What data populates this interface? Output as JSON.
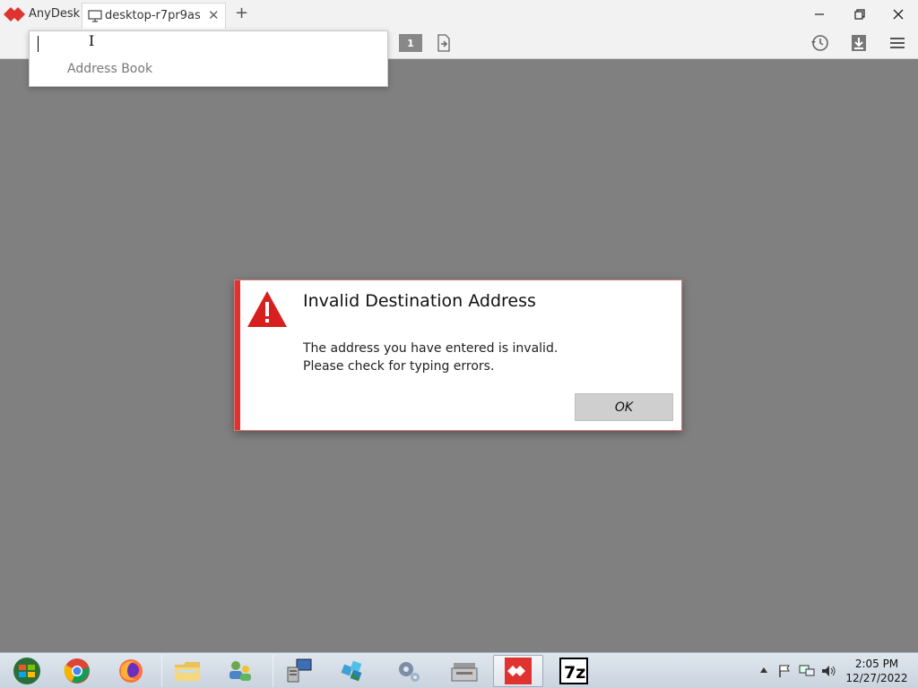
{
  "app": {
    "name": "AnyDesk",
    "tabs": [
      {
        "label": "desktop-r7pr9as"
      }
    ],
    "window_controls": {
      "minimize": "minimize-icon",
      "maximize": "restore-icon",
      "close": "close-icon"
    }
  },
  "toolbar": {
    "display_number": "1",
    "icons": [
      "monitor-number-icon",
      "file-transfer-icon",
      "history-icon",
      "download-icon",
      "menu-icon"
    ]
  },
  "address_dropdown": {
    "input_value": "",
    "address_book_label": "Address Book"
  },
  "dialog": {
    "title": "Invalid Destination Address",
    "message_line1": "The address you have entered is invalid.",
    "message_line2": "Please check for typing errors.",
    "ok_label": "OK",
    "accent_color": "#e0322f"
  },
  "taskbar": {
    "apps": [
      "start-orb-icon",
      "chrome-icon",
      "firefox-icon",
      "file-explorer-icon",
      "network-users-icon",
      "remote-desktop-icon",
      "network-icon",
      "settings-gears-icon",
      "cash-register-icon",
      "anydesk-icon",
      "7zip-icon"
    ],
    "tray_icons": [
      "show-hidden-icon",
      "flag-icon",
      "network-tray-icon",
      "volume-icon"
    ],
    "time": "2:05 PM",
    "date": "12/27/2022"
  },
  "colors": {
    "anydesk_red": "#e0322f",
    "background_gray": "#808080"
  }
}
